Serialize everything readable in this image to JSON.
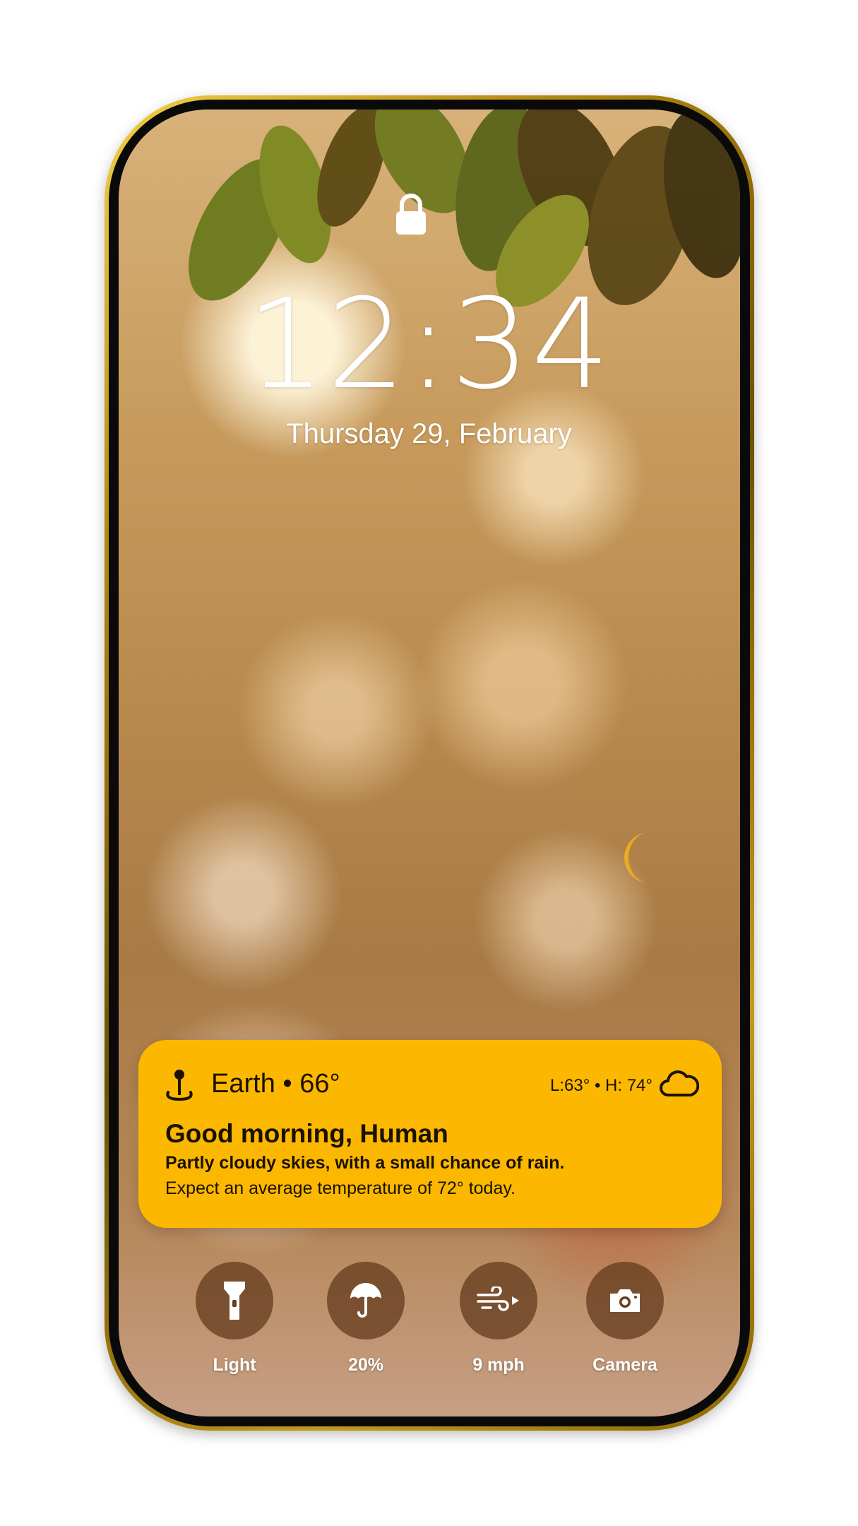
{
  "lockscreen": {
    "time": "12:34",
    "date": "Thursday 29, February"
  },
  "weather_widget": {
    "location": "Earth • 66°",
    "hilo": "L:63° • H: 74°",
    "greeting": "Good morning, Human",
    "summary": "Partly cloudy skies, with a small chance of rain.",
    "detail": "Expect an average temperature of 72° today.",
    "background_color": "#fcb800",
    "icons": [
      "location-pin-icon",
      "cloud-icon"
    ]
  },
  "quick_actions": [
    {
      "icon": "flashlight-icon",
      "label": "Light"
    },
    {
      "icon": "umbrella-icon",
      "label": "20%"
    },
    {
      "icon": "wind-icon",
      "label": "9 mph"
    },
    {
      "icon": "camera-icon",
      "label": "Camera"
    }
  ],
  "colors": {
    "frame": "#b38a10",
    "widget": "#fcb800",
    "action_button": "#5f3719"
  }
}
